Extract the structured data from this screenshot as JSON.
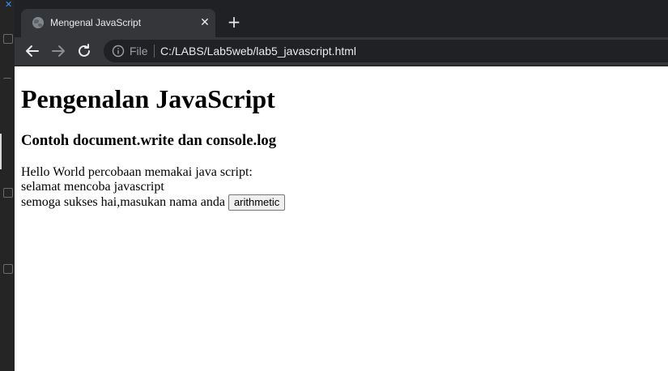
{
  "browser": {
    "tab": {
      "title": "Mengenal JavaScript",
      "close_glyph": "✕",
      "favicon": "globe-icon"
    },
    "new_tab_glyph": "+",
    "toolbar": {
      "back_icon": "back-arrow-icon",
      "forward_icon": "forward-arrow-icon",
      "reload_icon": "reload-icon",
      "info_icon": "info-icon",
      "scheme_label": "File",
      "url": "C:/LABS/Lab5web/lab5_javascript.html"
    }
  },
  "page": {
    "heading": "Pengenalan JavaScript",
    "subheading": "Contoh document.write dan console.log",
    "line1": "Hello World percobaan memakai java script:",
    "line2": "selamat mencoba javascript",
    "line3": "semoga sukses hai,masukan nama anda",
    "button_label": "arithmetic"
  },
  "colors": {
    "tabstrip_bg": "#202124",
    "active_tab_bg": "#35363a",
    "omnibox_bg": "#202124",
    "page_bg": "#ffffff"
  }
}
